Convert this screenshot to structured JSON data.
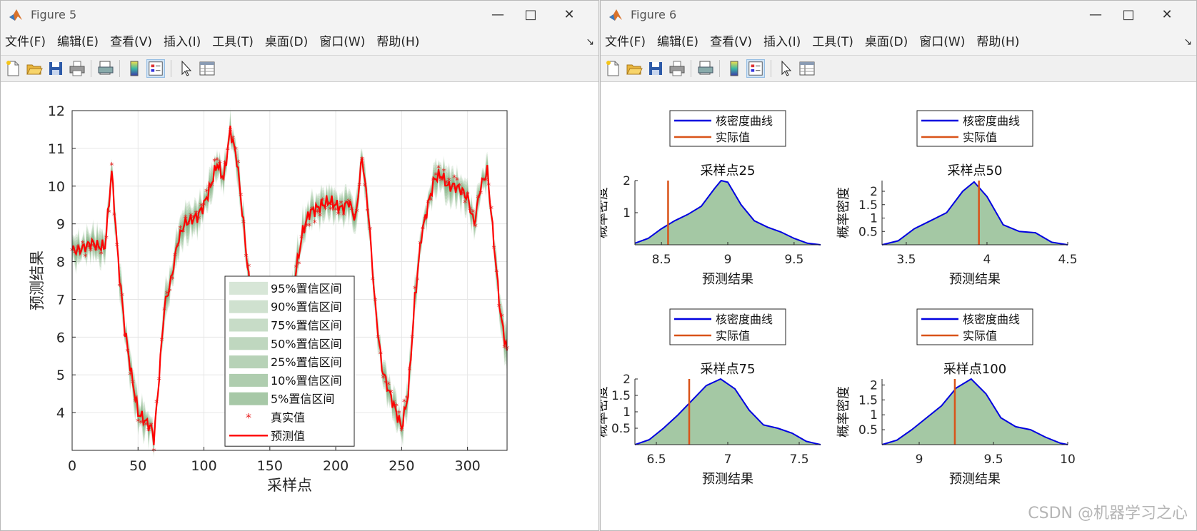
{
  "windows": {
    "fig5": {
      "title": "Figure 5"
    },
    "fig6": {
      "title": "Figure 6"
    }
  },
  "menu": [
    "文件(F)",
    "编辑(E)",
    "查看(V)",
    "插入(I)",
    "工具(T)",
    "桌面(D)",
    "窗口(W)",
    "帮助(H)"
  ],
  "toolbar_icons": [
    "new-figure-icon",
    "open-file-icon",
    "save-icon",
    "print-icon",
    "print-preview-icon",
    "insert-colorbar-icon",
    "insert-legend-icon",
    "edit-plot-cursor-icon",
    "property-inspector-icon"
  ],
  "watermark": "CSDN @机器学习之心",
  "chart_data": [
    {
      "type": "line",
      "title": "",
      "xlabel": "采样点",
      "ylabel": "预测结果",
      "xlim": [
        0,
        330
      ],
      "ylim": [
        3,
        12
      ],
      "xticks": [
        0,
        50,
        100,
        150,
        200,
        250,
        300
      ],
      "yticks": [
        4,
        5,
        6,
        7,
        8,
        9,
        10,
        11,
        12
      ],
      "grid": true,
      "legend_position": "bottom-center",
      "legend": [
        "95%置信区间",
        "90%置信区间",
        "75%置信区间",
        "50%置信区间",
        "25%置信区间",
        "10%置信区间",
        "5%置信区间",
        "真实值",
        "预测值"
      ],
      "x_key": [
        0,
        5,
        10,
        15,
        20,
        25,
        30,
        35,
        40,
        45,
        50,
        55,
        60,
        62,
        65,
        70,
        75,
        80,
        85,
        90,
        95,
        100,
        105,
        110,
        115,
        120,
        125,
        130,
        135,
        140,
        145,
        150,
        155,
        160,
        165,
        170,
        175,
        180,
        185,
        190,
        195,
        200,
        205,
        210,
        215,
        220,
        225,
        230,
        235,
        240,
        245,
        250,
        255,
        260,
        265,
        270,
        275,
        280,
        285,
        290,
        295,
        300,
        305,
        310,
        315,
        320,
        325,
        330
      ],
      "y_key": [
        8.3,
        8.3,
        8.4,
        8.5,
        8.4,
        8.4,
        10.4,
        8.0,
        6.2,
        5.0,
        4.0,
        3.8,
        3.6,
        3.3,
        4.5,
        6.8,
        7.5,
        8.5,
        9.0,
        9.1,
        9.2,
        9.5,
        10.0,
        10.6,
        10.2,
        11.5,
        10.7,
        9.0,
        7.2,
        5.5,
        5.0,
        4.5,
        4.9,
        5.8,
        6.6,
        7.8,
        8.8,
        9.3,
        9.4,
        9.5,
        9.6,
        9.5,
        9.4,
        9.6,
        9.1,
        10.8,
        9.2,
        6.8,
        5.2,
        4.6,
        4.1,
        3.6,
        4.5,
        7.0,
        8.7,
        9.5,
        10.2,
        10.3,
        10.0,
        10.0,
        9.9,
        9.7,
        9.0,
        10.0,
        10.4,
        8.5,
        6.6,
        5.6
      ],
      "series": [
        {
          "name": "真实值",
          "marker": "*",
          "color": "#e81b1b"
        },
        {
          "name": "预测值",
          "color": "#ff0000"
        }
      ],
      "band_color": "#7aab7a"
    },
    {
      "type": "area",
      "title": "采样点25",
      "xlabel": "预测结果",
      "ylabel": "概率密度",
      "xlim": [
        8.3,
        9.7
      ],
      "ylim": [
        0,
        2.0
      ],
      "xticks": [
        8.5,
        9,
        9.5
      ],
      "yticks": [
        1,
        2
      ],
      "legend": [
        "核密度曲线",
        "实际值"
      ],
      "x": [
        8.3,
        8.4,
        8.5,
        8.6,
        8.7,
        8.8,
        8.9,
        8.95,
        9.0,
        9.1,
        9.2,
        9.3,
        9.4,
        9.5,
        9.6,
        9.7
      ],
      "y": [
        0.05,
        0.2,
        0.5,
        0.75,
        0.95,
        1.2,
        1.75,
        2.0,
        1.95,
        1.25,
        0.75,
        0.55,
        0.4,
        0.2,
        0.05,
        0.0
      ],
      "actual": 8.55
    },
    {
      "type": "area",
      "title": "采样点50",
      "xlabel": "预测结果",
      "ylabel": "概率密度",
      "xlim": [
        3.35,
        4.5
      ],
      "ylim": [
        0,
        2.4
      ],
      "xticks": [
        3.5,
        4,
        4.5
      ],
      "yticks": [
        0.5,
        1,
        1.5,
        2
      ],
      "legend": [
        "核密度曲线",
        "实际值"
      ],
      "x": [
        3.35,
        3.45,
        3.55,
        3.65,
        3.75,
        3.85,
        3.92,
        4.0,
        4.1,
        4.2,
        4.3,
        4.4,
        4.5
      ],
      "y": [
        0.0,
        0.15,
        0.6,
        0.9,
        1.2,
        2.0,
        2.35,
        1.8,
        0.75,
        0.5,
        0.45,
        0.1,
        0.0
      ],
      "actual": 3.95
    },
    {
      "type": "area",
      "title": "采样点75",
      "xlabel": "预测结果",
      "ylabel": "概率密度",
      "xlim": [
        6.35,
        7.65
      ],
      "ylim": [
        0,
        2.0
      ],
      "xticks": [
        6.5,
        7,
        7.5
      ],
      "yticks": [
        0.5,
        1,
        1.5,
        2
      ],
      "legend": [
        "核密度曲线",
        "实际值"
      ],
      "x": [
        6.35,
        6.45,
        6.55,
        6.65,
        6.75,
        6.85,
        6.95,
        7.05,
        7.15,
        7.25,
        7.35,
        7.45,
        7.55,
        7.65
      ],
      "y": [
        0.0,
        0.15,
        0.5,
        0.9,
        1.35,
        1.8,
        2.0,
        1.7,
        1.05,
        0.6,
        0.5,
        0.35,
        0.1,
        0.0
      ],
      "actual": 6.73
    },
    {
      "type": "area",
      "title": "采样点100",
      "xlabel": "预测结果",
      "ylabel": "概率密度",
      "xlim": [
        8.75,
        10.0
      ],
      "ylim": [
        0,
        2.2
      ],
      "xticks": [
        9,
        9.5,
        10
      ],
      "yticks": [
        0.5,
        1,
        1.5,
        2
      ],
      "legend": [
        "核密度曲线",
        "实际值"
      ],
      "x": [
        8.75,
        8.85,
        8.95,
        9.05,
        9.15,
        9.25,
        9.35,
        9.45,
        9.55,
        9.65,
        9.75,
        9.85,
        9.95,
        10.0
      ],
      "y": [
        0.0,
        0.15,
        0.5,
        0.9,
        1.3,
        1.9,
        2.2,
        1.7,
        0.9,
        0.6,
        0.5,
        0.25,
        0.05,
        0.0
      ],
      "actual": 9.24
    }
  ]
}
